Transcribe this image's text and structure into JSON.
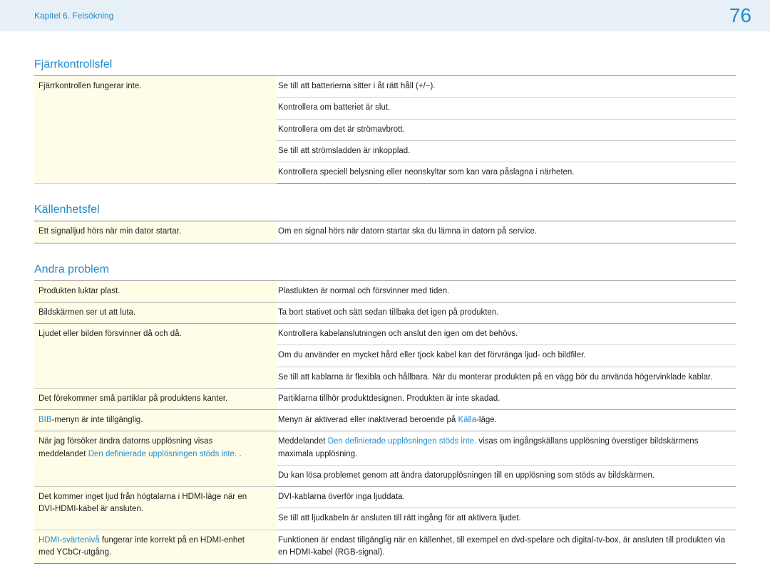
{
  "header": {
    "chapter": "Kapitel 6. Felsökning",
    "page_number": "76"
  },
  "sections": [
    {
      "title": "Fjärrkontrollsfel",
      "groups": [
        {
          "problem": {
            "text": "Fjärrkontrollen fungerar inte."
          },
          "solutions": [
            {
              "text": "Se till att batterierna sitter i åt rätt håll (+/−)."
            },
            {
              "text": "Kontrollera om batteriet är slut."
            },
            {
              "text": "Kontrollera om det är strömavbrott."
            },
            {
              "text": "Se till att strömsladden är inkopplad."
            },
            {
              "text": "Kontrollera speciell belysning eller neonskyltar som kan vara påslagna i närheten."
            }
          ]
        }
      ]
    },
    {
      "title": "Källenhetsfel",
      "groups": [
        {
          "problem": {
            "text": "Ett signalljud hörs när min dator startar."
          },
          "solutions": [
            {
              "text": "Om en signal hörs när datorn startar ska du lämna in datorn på service."
            }
          ]
        }
      ]
    },
    {
      "title": "Andra problem",
      "groups": [
        {
          "problem": {
            "text": "Produkten luktar plast."
          },
          "solutions": [
            {
              "text": "Plastlukten är normal och försvinner med tiden."
            }
          ]
        },
        {
          "problem": {
            "text": "Bildskärmen ser ut att luta."
          },
          "solutions": [
            {
              "text": "Ta bort stativet och sätt sedan tillbaka det igen på produkten."
            }
          ]
        },
        {
          "problem": {
            "text": "Ljudet eller bilden försvinner då och då."
          },
          "solutions": [
            {
              "text": "Kontrollera kabelanslutningen och anslut den igen om det behövs."
            },
            {
              "parts": [
                {
                  "t": "Om du använder en mycket hård eller tjock kabel kan det förvränga ljud- och bildfiler."
                }
              ]
            },
            {
              "parts": [
                {
                  "t": "Se till att kablarna är flexibla och hållbara. När du monterar produkten på en vägg bör du använda högervinklade kablar."
                }
              ]
            }
          ]
        },
        {
          "problem": {
            "text": "Det förekommer små partiklar på produktens kanter."
          },
          "solutions": [
            {
              "text": "Partiklarna tillhör produktdesignen. Produkten är inte skadad."
            }
          ]
        },
        {
          "problem": {
            "parts": [
              {
                "t": "BIB",
                "hl": true
              },
              {
                "t": "-menyn är inte tillgänglig."
              }
            ]
          },
          "solutions": [
            {
              "parts": [
                {
                  "t": "Menyn är aktiverad eller inaktiverad beroende på "
                },
                {
                  "t": "Källa",
                  "hl": true
                },
                {
                  "t": "-läge."
                }
              ]
            }
          ]
        },
        {
          "problem": {
            "parts": [
              {
                "t": "När jag försöker ändra datorns upplösning visas meddelandet "
              },
              {
                "t": "Den definierade upplösningen stöds inte.",
                "hl": true
              },
              {
                "t": " ."
              }
            ]
          },
          "solutions": [
            {
              "parts": [
                {
                  "t": "Meddelandet "
                },
                {
                  "t": "Den definierade upplösningen stöds inte.",
                  "hl": true
                },
                {
                  "t": " visas om ingångskällans upplösning överstiger bildskärmens maximala upplösning."
                }
              ]
            },
            {
              "text": "Du kan lösa problemet genom att ändra datorupplösningen till en upplösning som stöds av bildskärmen."
            }
          ]
        },
        {
          "problem": {
            "text": "Det kommer inget ljud från högtalarna i HDMI-läge när en DVI-HDMI-kabel är ansluten."
          },
          "solutions": [
            {
              "text": "DVI-kablarna överför inga ljuddata."
            },
            {
              "text": "Se till att ljudkabeln är ansluten till rätt ingång för att aktivera ljudet."
            }
          ]
        },
        {
          "problem": {
            "parts": [
              {
                "t": "HDMI-svärtenivå",
                "hl": true
              },
              {
                "t": " fungerar inte korrekt på en HDMI-enhet med YCbCr-utgång."
              }
            ]
          },
          "solutions": [
            {
              "text": "Funktionen är endast tillgänglig när en källenhet, till exempel en dvd-spelare och digital-tv-box, är ansluten till produkten via en HDMI-kabel (RGB-signal)."
            }
          ]
        }
      ]
    }
  ]
}
